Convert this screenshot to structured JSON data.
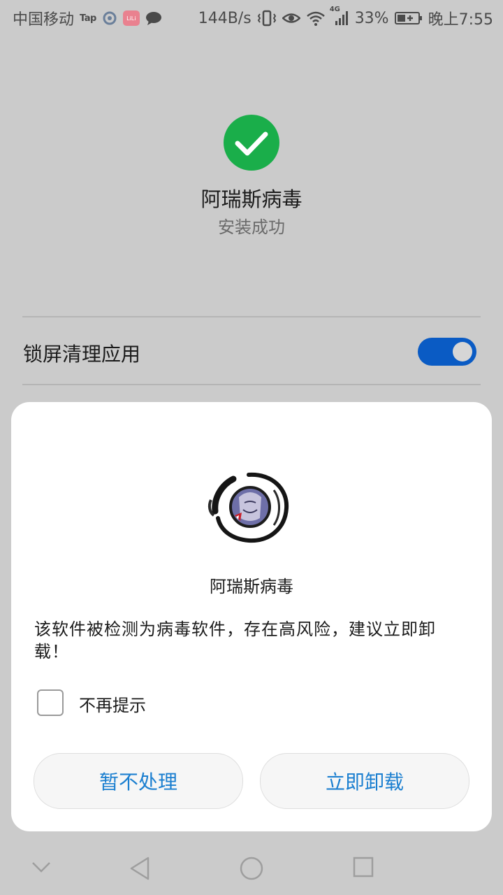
{
  "status_bar": {
    "carrier": "中国移动",
    "tap_label": "Tap",
    "pink_app_label": "LiLi",
    "net_speed": "144B/s",
    "network_label": "4G",
    "battery_percent": "33%",
    "time": "晚上7:55",
    "icons": [
      "signal-carrier",
      "tap-app-icon",
      "target-app-icon",
      "lili-app-icon",
      "chat-bubble-icon",
      "vibrate-icon",
      "eye-icon",
      "wifi-icon",
      "cellular-signal-icon",
      "battery-charging-icon"
    ]
  },
  "background": {
    "success_icon": "checkmark-icon",
    "app_name": "阿瑞斯病毒",
    "install_status": "安装成功",
    "lock_screen_setting": {
      "label": "锁屏清理应用",
      "enabled": true
    },
    "colors": {
      "success": "#1aae4a",
      "toggle": "#0a5bc4"
    }
  },
  "dialog": {
    "app_icon": "app-logo-icon",
    "app_name": "阿瑞斯病毒",
    "message": "该软件被检测为病毒软件，存在高风险，建议立即卸载！",
    "checkbox_label": "不再提示",
    "checkbox_checked": false,
    "buttons": {
      "later": "暂不处理",
      "uninstall": "立即卸载"
    },
    "colors": {
      "button_text": "#1b7fd0"
    }
  },
  "nav_bar": {
    "icons": [
      "chevron-down-icon",
      "back-icon",
      "home-icon",
      "recents-icon"
    ]
  }
}
